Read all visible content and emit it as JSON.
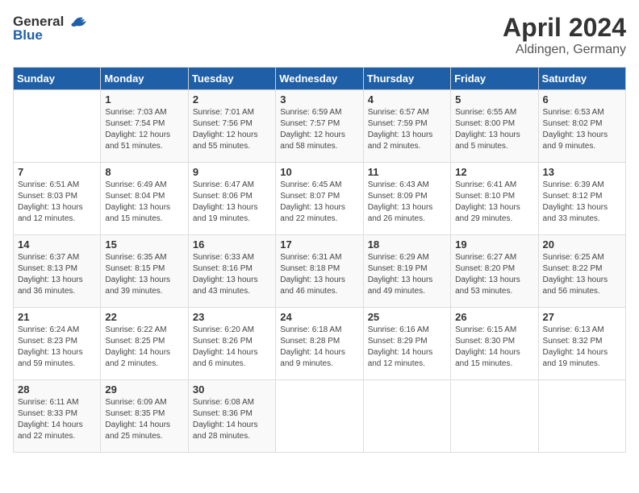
{
  "logo": {
    "text_general": "General",
    "text_blue": "Blue"
  },
  "header": {
    "month": "April 2024",
    "location": "Aldingen, Germany"
  },
  "days_of_week": [
    "Sunday",
    "Monday",
    "Tuesday",
    "Wednesday",
    "Thursday",
    "Friday",
    "Saturday"
  ],
  "weeks": [
    [
      {
        "day": "",
        "info": ""
      },
      {
        "day": "1",
        "sunrise": "Sunrise: 7:03 AM",
        "sunset": "Sunset: 7:54 PM",
        "daylight": "Daylight: 12 hours and 51 minutes."
      },
      {
        "day": "2",
        "sunrise": "Sunrise: 7:01 AM",
        "sunset": "Sunset: 7:56 PM",
        "daylight": "Daylight: 12 hours and 55 minutes."
      },
      {
        "day": "3",
        "sunrise": "Sunrise: 6:59 AM",
        "sunset": "Sunset: 7:57 PM",
        "daylight": "Daylight: 12 hours and 58 minutes."
      },
      {
        "day": "4",
        "sunrise": "Sunrise: 6:57 AM",
        "sunset": "Sunset: 7:59 PM",
        "daylight": "Daylight: 13 hours and 2 minutes."
      },
      {
        "day": "5",
        "sunrise": "Sunrise: 6:55 AM",
        "sunset": "Sunset: 8:00 PM",
        "daylight": "Daylight: 13 hours and 5 minutes."
      },
      {
        "day": "6",
        "sunrise": "Sunrise: 6:53 AM",
        "sunset": "Sunset: 8:02 PM",
        "daylight": "Daylight: 13 hours and 9 minutes."
      }
    ],
    [
      {
        "day": "7",
        "sunrise": "Sunrise: 6:51 AM",
        "sunset": "Sunset: 8:03 PM",
        "daylight": "Daylight: 13 hours and 12 minutes."
      },
      {
        "day": "8",
        "sunrise": "Sunrise: 6:49 AM",
        "sunset": "Sunset: 8:04 PM",
        "daylight": "Daylight: 13 hours and 15 minutes."
      },
      {
        "day": "9",
        "sunrise": "Sunrise: 6:47 AM",
        "sunset": "Sunset: 8:06 PM",
        "daylight": "Daylight: 13 hours and 19 minutes."
      },
      {
        "day": "10",
        "sunrise": "Sunrise: 6:45 AM",
        "sunset": "Sunset: 8:07 PM",
        "daylight": "Daylight: 13 hours and 22 minutes."
      },
      {
        "day": "11",
        "sunrise": "Sunrise: 6:43 AM",
        "sunset": "Sunset: 8:09 PM",
        "daylight": "Daylight: 13 hours and 26 minutes."
      },
      {
        "day": "12",
        "sunrise": "Sunrise: 6:41 AM",
        "sunset": "Sunset: 8:10 PM",
        "daylight": "Daylight: 13 hours and 29 minutes."
      },
      {
        "day": "13",
        "sunrise": "Sunrise: 6:39 AM",
        "sunset": "Sunset: 8:12 PM",
        "daylight": "Daylight: 13 hours and 33 minutes."
      }
    ],
    [
      {
        "day": "14",
        "sunrise": "Sunrise: 6:37 AM",
        "sunset": "Sunset: 8:13 PM",
        "daylight": "Daylight: 13 hours and 36 minutes."
      },
      {
        "day": "15",
        "sunrise": "Sunrise: 6:35 AM",
        "sunset": "Sunset: 8:15 PM",
        "daylight": "Daylight: 13 hours and 39 minutes."
      },
      {
        "day": "16",
        "sunrise": "Sunrise: 6:33 AM",
        "sunset": "Sunset: 8:16 PM",
        "daylight": "Daylight: 13 hours and 43 minutes."
      },
      {
        "day": "17",
        "sunrise": "Sunrise: 6:31 AM",
        "sunset": "Sunset: 8:18 PM",
        "daylight": "Daylight: 13 hours and 46 minutes."
      },
      {
        "day": "18",
        "sunrise": "Sunrise: 6:29 AM",
        "sunset": "Sunset: 8:19 PM",
        "daylight": "Daylight: 13 hours and 49 minutes."
      },
      {
        "day": "19",
        "sunrise": "Sunrise: 6:27 AM",
        "sunset": "Sunset: 8:20 PM",
        "daylight": "Daylight: 13 hours and 53 minutes."
      },
      {
        "day": "20",
        "sunrise": "Sunrise: 6:25 AM",
        "sunset": "Sunset: 8:22 PM",
        "daylight": "Daylight: 13 hours and 56 minutes."
      }
    ],
    [
      {
        "day": "21",
        "sunrise": "Sunrise: 6:24 AM",
        "sunset": "Sunset: 8:23 PM",
        "daylight": "Daylight: 13 hours and 59 minutes."
      },
      {
        "day": "22",
        "sunrise": "Sunrise: 6:22 AM",
        "sunset": "Sunset: 8:25 PM",
        "daylight": "Daylight: 14 hours and 2 minutes."
      },
      {
        "day": "23",
        "sunrise": "Sunrise: 6:20 AM",
        "sunset": "Sunset: 8:26 PM",
        "daylight": "Daylight: 14 hours and 6 minutes."
      },
      {
        "day": "24",
        "sunrise": "Sunrise: 6:18 AM",
        "sunset": "Sunset: 8:28 PM",
        "daylight": "Daylight: 14 hours and 9 minutes."
      },
      {
        "day": "25",
        "sunrise": "Sunrise: 6:16 AM",
        "sunset": "Sunset: 8:29 PM",
        "daylight": "Daylight: 14 hours and 12 minutes."
      },
      {
        "day": "26",
        "sunrise": "Sunrise: 6:15 AM",
        "sunset": "Sunset: 8:30 PM",
        "daylight": "Daylight: 14 hours and 15 minutes."
      },
      {
        "day": "27",
        "sunrise": "Sunrise: 6:13 AM",
        "sunset": "Sunset: 8:32 PM",
        "daylight": "Daylight: 14 hours and 19 minutes."
      }
    ],
    [
      {
        "day": "28",
        "sunrise": "Sunrise: 6:11 AM",
        "sunset": "Sunset: 8:33 PM",
        "daylight": "Daylight: 14 hours and 22 minutes."
      },
      {
        "day": "29",
        "sunrise": "Sunrise: 6:09 AM",
        "sunset": "Sunset: 8:35 PM",
        "daylight": "Daylight: 14 hours and 25 minutes."
      },
      {
        "day": "30",
        "sunrise": "Sunrise: 6:08 AM",
        "sunset": "Sunset: 8:36 PM",
        "daylight": "Daylight: 14 hours and 28 minutes."
      },
      {
        "day": "",
        "info": ""
      },
      {
        "day": "",
        "info": ""
      },
      {
        "day": "",
        "info": ""
      },
      {
        "day": "",
        "info": ""
      }
    ]
  ]
}
